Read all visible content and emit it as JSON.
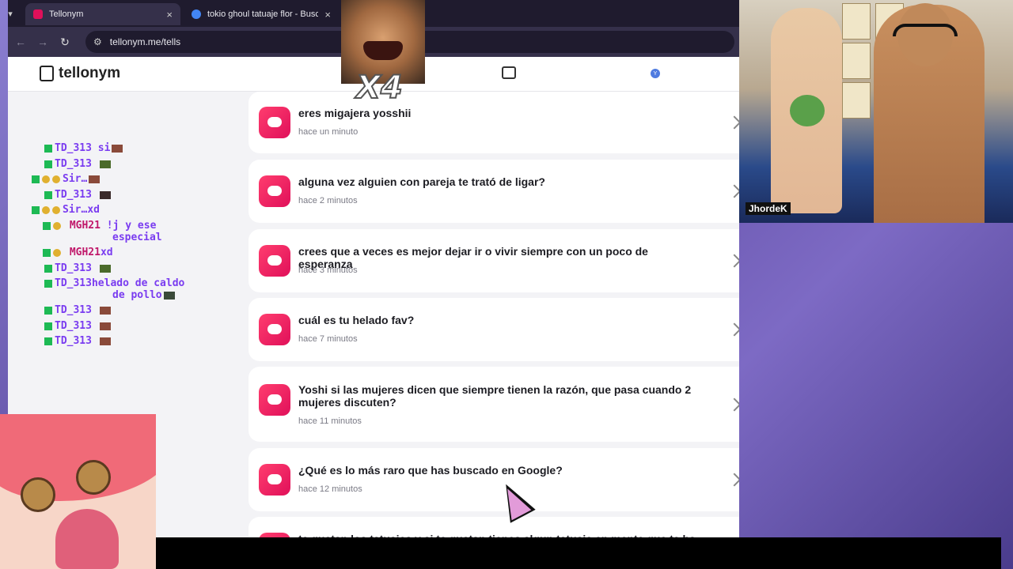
{
  "browser": {
    "tabs": [
      {
        "title": "Tellonym",
        "active": true
      },
      {
        "title": "tokio ghoul tatuaje flor - Buscar",
        "active": false
      }
    ],
    "url": "tellonym.me/tells"
  },
  "site": {
    "logo_text": "tellonym",
    "avatar_letter": "Y"
  },
  "tells": [
    {
      "question": "eres migajera yosshii",
      "time": "hace un minuto"
    },
    {
      "question": "alguna vez alguien con pareja te trató de ligar?",
      "time": "hace 2 minutos"
    },
    {
      "question": "crees que a veces es mejor dejar ir o vivir siempre con un poco de esperanza",
      "time": "hace 3 minutos"
    },
    {
      "question": "cuál es tu helado fav?",
      "time": "hace 7 minutos"
    },
    {
      "question": "Yoshi si las mujeres dicen que siempre tienen la razón, que pasa cuando 2 mujeres discuten?",
      "time": "hace 11 minutos"
    },
    {
      "question": "¿Qué es lo más raro que has buscado en Google?",
      "time": "hace 12 minutos"
    },
    {
      "question": "te gustan los tatuajes y si te gustan tienes algun tatuaje en mente que te harias?",
      "time": ""
    }
  ],
  "chat": [
    {
      "user": "TD_313",
      "text": "si"
    },
    {
      "user": "TD_313",
      "text": ""
    },
    {
      "user": "Sir…",
      "text": ""
    },
    {
      "user": "TD_313",
      "text": ""
    },
    {
      "user": "Sir…",
      "text": "xd"
    },
    {
      "user": "MGH21",
      "text": "!j y ese"
    },
    {
      "user": "",
      "text": "especial"
    },
    {
      "user": "MGH21",
      "text": "xd"
    },
    {
      "user": "TD_313",
      "text": ""
    },
    {
      "user": "TD_313",
      "text": "helado de caldo"
    },
    {
      "user": "",
      "text": "de pollo"
    },
    {
      "user": "TD_313",
      "text": ""
    },
    {
      "user": "TD_313",
      "text": ""
    },
    {
      "user": "TD_313",
      "text": ""
    }
  ],
  "overlay": {
    "multiplier": "X4",
    "cam_name": "JhordeK"
  }
}
